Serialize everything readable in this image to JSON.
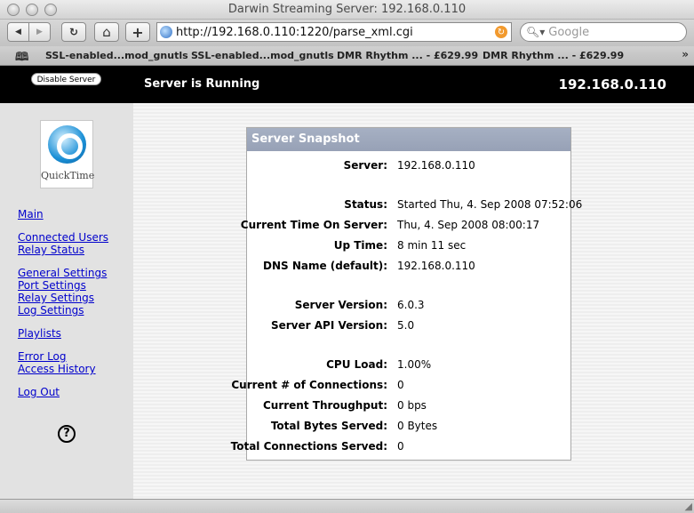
{
  "window": {
    "title": "Darwin Streaming Server: 192.168.0.110"
  },
  "toolbar": {
    "back_glyph": "◀",
    "forward_glyph": "▶",
    "reload_glyph": "↻",
    "home_glyph": "⌂",
    "add_glyph": "+",
    "url": "http://192.168.0.110:1220/parse_xml.cgi",
    "search_placeholder": "Google"
  },
  "bookmarks": {
    "items": [
      {
        "label": "SSL-enabled...mod_gnutls"
      },
      {
        "label": "SSL-enabled...mod_gnutls"
      },
      {
        "label": "DMR Rhythm ... - £629.99"
      },
      {
        "label": "DMR Rhythm ... - £629.99"
      }
    ],
    "more_glyph": "»"
  },
  "header": {
    "disable_button": "Disable Server",
    "status": "Server is Running",
    "ip": "192.168.0.110"
  },
  "sidebar": {
    "logo_text": "QuickTime",
    "links": {
      "main": "Main",
      "connected_users": "Connected Users",
      "relay_status": "Relay Status",
      "general_settings": "General Settings",
      "port_settings": "Port Settings",
      "relay_settings": "Relay Settings",
      "log_settings": "Log Settings",
      "playlists": "Playlists",
      "error_log": "Error Log",
      "access_history": "Access History",
      "log_out": "Log Out"
    },
    "help_glyph": "?"
  },
  "snapshot": {
    "title": "Server Snapshot",
    "rows": [
      {
        "label": "Server:",
        "value": "192.168.0.110"
      },
      {
        "label": "Status:",
        "value": "Started Thu, 4. Sep 2008 07:52:06"
      },
      {
        "label": "Current Time On Server:",
        "value": "Thu, 4. Sep 2008 08:00:17"
      },
      {
        "label": "Up Time:",
        "value": "8 min 11 sec"
      },
      {
        "label": "DNS Name (default):",
        "value": "192.168.0.110"
      },
      {
        "label": "Server Version:",
        "value": "6.0.3"
      },
      {
        "label": "Server API Version:",
        "value": "5.0"
      },
      {
        "label": "CPU Load:",
        "value": "1.00%"
      },
      {
        "label": "Current # of Connections:",
        "value": "0"
      },
      {
        "label": "Current Throughput:",
        "value": "0 bps"
      },
      {
        "label": "Total Bytes Served:",
        "value": "0 Bytes"
      },
      {
        "label": "Total Connections Served:",
        "value": "0"
      }
    ]
  }
}
